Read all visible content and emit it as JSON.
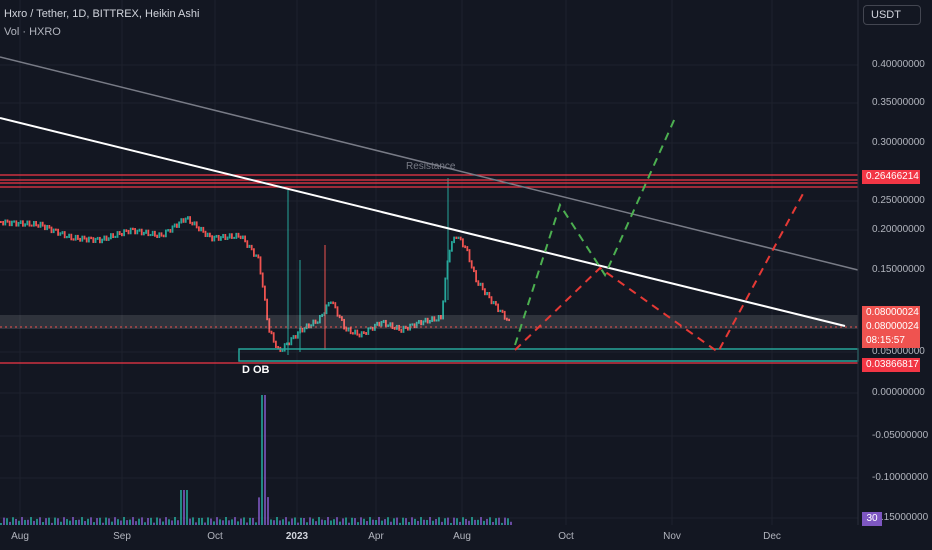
{
  "header": {
    "title": "Hxro / Tether, 1D, BITTREX, Heikin Ashi",
    "volume": "Vol · HXRO"
  },
  "currency_button": "USDT",
  "price_axis": {
    "ticks": [
      "0.40000000",
      "0.35000000",
      "0.30000000",
      "0.25000000",
      "0.20000000",
      "0.15000000",
      "0.05000000",
      "0.00000000",
      "-0.05000000",
      "-0.10000000",
      "-0.15000000"
    ],
    "labels": {
      "resistance": "0.26466214",
      "sma": "0.08000024",
      "last_price": "0.08000024",
      "countdown": "08:15:57",
      "support": "0.03866817"
    },
    "volume_badge": "30"
  },
  "time_axis": [
    "Aug",
    "Sep",
    "Oct",
    "2023",
    "Apr",
    "Aug",
    "Oct",
    "Nov",
    "Dec"
  ],
  "annotations": {
    "resistance_text": "Resistance",
    "order_block_text": "D OB"
  },
  "colors": {
    "background": "#131722",
    "up": "#26a69a",
    "down": "#ef5350",
    "resistance_line": "#f23645",
    "trendline": "#ffffff",
    "volume": "#7e57c2"
  }
}
